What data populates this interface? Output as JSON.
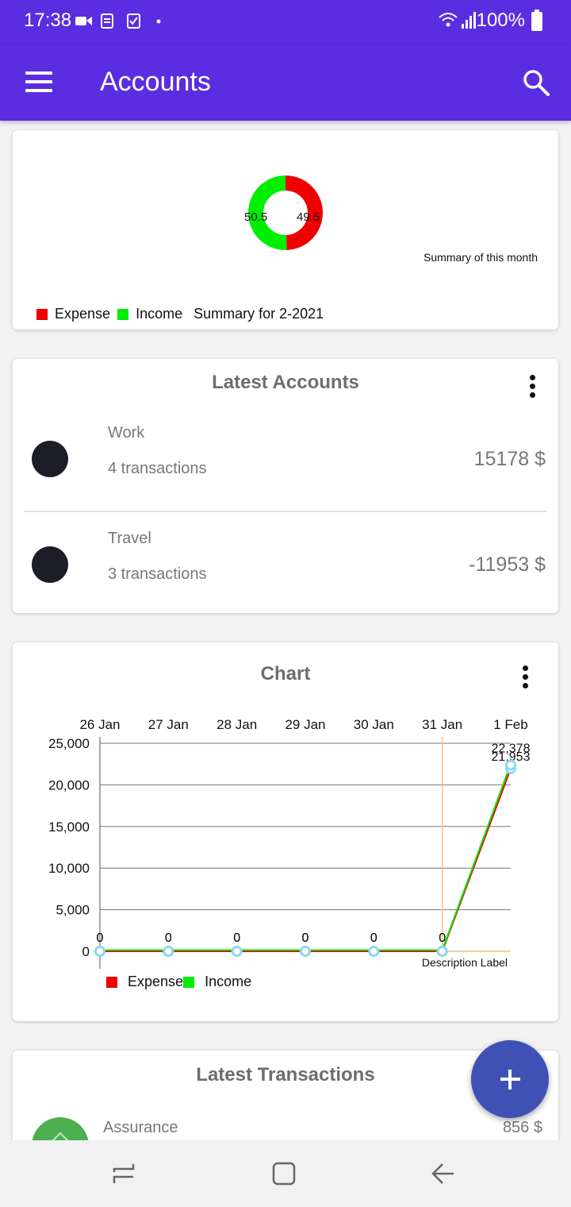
{
  "status_bar": {
    "time": "17:38",
    "battery": "100%"
  },
  "app_bar": {
    "title": "Accounts",
    "menu_icon": "hamburger-menu-icon",
    "search_icon": "search-icon"
  },
  "summary": {
    "slices": [
      {
        "label": "Income",
        "value": 50.5,
        "color": "#00ee00"
      },
      {
        "label": "Expense",
        "value": 49.5,
        "color": "#ee0000"
      }
    ],
    "left_value": "50.5",
    "right_value": "49.5",
    "description": "Summary of this month",
    "legend": {
      "expense": "Expense",
      "income": "Income",
      "period": "Summary for 2-2021"
    },
    "colors": {
      "expense": "#ee0000",
      "income": "#00ee00"
    }
  },
  "latest_accounts": {
    "title": "Latest Accounts",
    "items": [
      {
        "name": "Work",
        "transactions": "4 transactions",
        "amount": "15178 $"
      },
      {
        "name": "Travel",
        "transactions": "3 transactions",
        "amount": "-11953 $"
      }
    ]
  },
  "chart_card": {
    "title": "Chart",
    "description": "Description Label",
    "legend": {
      "expense": "Expense",
      "income": "Income"
    }
  },
  "chart_data": {
    "type": "line",
    "categories": [
      "26 Jan",
      "27 Jan",
      "28 Jan",
      "29 Jan",
      "30 Jan",
      "31 Jan",
      "1 Feb"
    ],
    "series": [
      {
        "name": "Expense",
        "color": "#ee0000",
        "values": [
          0,
          0,
          0,
          0,
          0,
          0,
          21953
        ],
        "labels": [
          "0",
          "0",
          "0",
          "0",
          "0",
          "0",
          "21,953"
        ]
      },
      {
        "name": "Income",
        "color": "#00ee00",
        "values": [
          0,
          0,
          0,
          0,
          0,
          0,
          22378
        ],
        "labels": [
          "0",
          "0",
          "0",
          "0",
          "0",
          "0",
          "22,378"
        ]
      }
    ],
    "yticks": [
      0,
      5000,
      10000,
      15000,
      20000,
      25000
    ],
    "ytick_labels": [
      "0",
      "5,000",
      "10,000",
      "15,000",
      "20,000",
      "25,000"
    ],
    "ylim": [
      0,
      25000
    ],
    "grid": true,
    "legend": "bottom-left"
  },
  "latest_transactions": {
    "title": "Latest Transactions",
    "items": [
      {
        "name": "Assurance",
        "amount": "856 $"
      }
    ]
  },
  "fab_icon": "plus-icon",
  "nav_bar": {
    "recents_icon": "recents-icon",
    "home_icon": "home-icon",
    "back_icon": "back-icon"
  }
}
